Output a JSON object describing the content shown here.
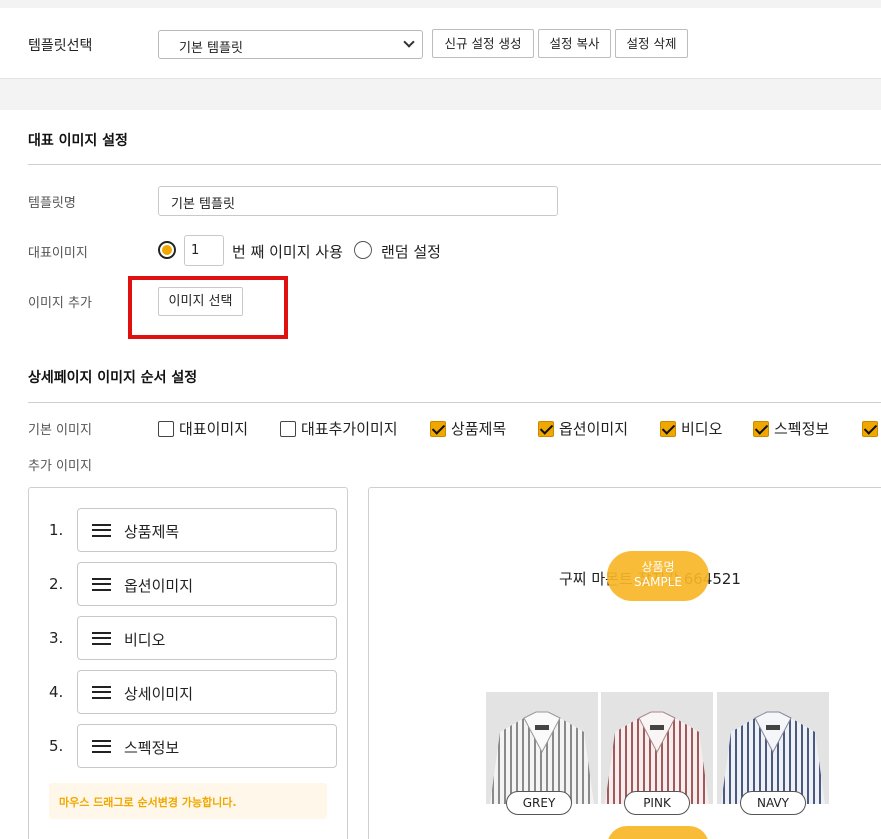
{
  "template_bar": {
    "label": "템플릿선택",
    "selected": "기본 템플릿",
    "buttons": {
      "create": "신규 설정 생성",
      "copy": "설정 복사",
      "delete": "설정 삭제"
    }
  },
  "rep_section": {
    "title": "대표 이미지 설정",
    "name_label": "템플릿명",
    "name_value": "기본 템플릿",
    "rep_label": "대표이미지",
    "rep_number": "1",
    "rep_suffix": "번 째 이미지 사용",
    "random_label": "랜덤 설정",
    "add_label": "이미지 추가",
    "add_button": "이미지 선택"
  },
  "order_section": {
    "title": "상세페이지 이미지 순서 설정",
    "basic_label": "기본 이미지",
    "extra_label": "추가 이미지",
    "checkboxes": [
      {
        "label": "대표이미지",
        "checked": false
      },
      {
        "label": "대표추가이미지",
        "checked": false
      },
      {
        "label": "상품제목",
        "checked": true
      },
      {
        "label": "옵션이미지",
        "checked": true
      },
      {
        "label": "비디오",
        "checked": true
      },
      {
        "label": "스펙정보",
        "checked": true
      }
    ],
    "list": [
      {
        "num": "1.",
        "label": "상품제목"
      },
      {
        "num": "2.",
        "label": "옵션이미지"
      },
      {
        "num": "3.",
        "label": "비디오"
      },
      {
        "num": "4.",
        "label": "상세이미지"
      },
      {
        "num": "5.",
        "label": "스펙정보"
      }
    ],
    "hint": "마우스 드래그로 순서변경 가능합니다."
  },
  "preview": {
    "product_title": "구찌 마몬트 장지갑 664521",
    "sample_line1": "상품명",
    "sample_line2": "SAMPLE",
    "colors": [
      "GREY",
      "PINK",
      "NAVY"
    ]
  },
  "colors": {
    "accent": "#f0a800",
    "highlight": "#e01010",
    "bubble": "#f8b628"
  }
}
